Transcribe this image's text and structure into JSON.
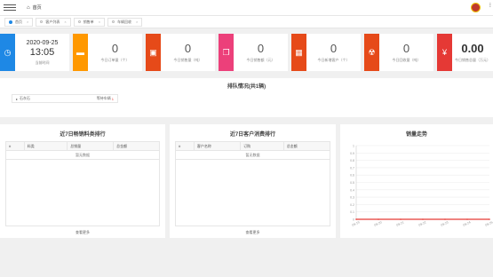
{
  "header": {
    "home_icon": "home-icon",
    "home_label": "首页"
  },
  "tabs": [
    {
      "label": "首页",
      "active": true
    },
    {
      "label": "客户列表",
      "active": false
    },
    {
      "label": "销售单",
      "active": false
    },
    {
      "label": "车辆回收",
      "active": false
    }
  ],
  "stats": {
    "clock": {
      "date": "2020-09-25",
      "time": "13:05",
      "label": "当前时间"
    },
    "orders_today": {
      "value": "0",
      "label": "今日订单量（个）",
      "color": "#ff9800"
    },
    "sales_today": {
      "value": "0",
      "label": "今日销售量（吨）",
      "color": "#e64a19"
    },
    "sales_amount": {
      "value": "0",
      "label": "今日销售额（元）",
      "color": "#ec407a"
    },
    "new_customers": {
      "value": "0",
      "label": "今日新增客户（个）",
      "color": "#e64a19"
    },
    "recycle_today": {
      "value": "0",
      "label": "今日回收量（吨）",
      "color": "#e64a19"
    },
    "sales_total": {
      "value": "0.00",
      "label": "今日销售总量（万元）",
      "color": "#e53935"
    }
  },
  "queue": {
    "title": "排队情况(共1辆)",
    "row_label": "石灰石",
    "row_text": "等待车辆",
    "row_count": "1"
  },
  "product_rank": {
    "title": "近7日畅销料类排行",
    "headers": [
      "#",
      "料类",
      "总销量",
      "总金额"
    ],
    "empty": "暂无数据",
    "more": "查看更多"
  },
  "customer_rank": {
    "title": "近7日客户消费排行",
    "headers": [
      "#",
      "客户名称",
      "订购",
      "总金额"
    ],
    "empty": "暂无数据",
    "more": "查看更多"
  },
  "chart_data": {
    "type": "line",
    "title": "销量走势",
    "x": [
      "09-19",
      "09-20",
      "09-21",
      "09-22",
      "09-23",
      "09-24",
      "09-25"
    ],
    "series": [
      {
        "values": [
          0,
          0,
          0,
          0,
          0,
          0,
          0
        ],
        "color": "#e53935"
      }
    ],
    "ylim": [
      0,
      1
    ],
    "yticks": [
      "0",
      "0.1",
      "0.2",
      "0.3",
      "0.4",
      "0.5",
      "0.6",
      "0.7",
      "0.8",
      "0.9",
      "1"
    ],
    "grid": true
  }
}
